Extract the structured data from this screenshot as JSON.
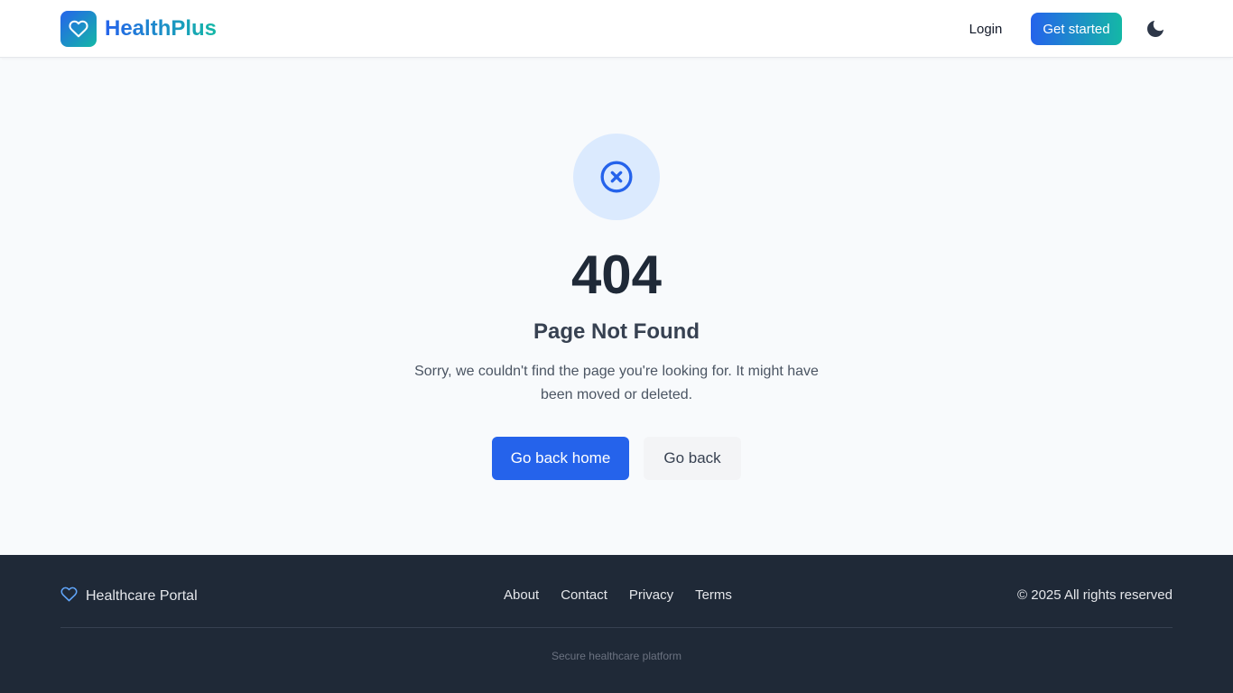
{
  "header": {
    "brand": "HealthPlus",
    "login_label": "Login",
    "get_started_label": "Get started",
    "theme_icon": "moon-icon"
  },
  "error": {
    "icon": "x-circle-icon",
    "code": "404",
    "title": "Page Not Found",
    "message": "Sorry, we couldn't find the page you're looking for. It might have been moved or deleted.",
    "home_button": "Go back home",
    "back_button": "Go back"
  },
  "footer": {
    "brand": "Healthcare Portal",
    "brand_icon": "heart-icon",
    "links": [
      {
        "label": "About"
      },
      {
        "label": "Contact"
      },
      {
        "label": "Privacy"
      },
      {
        "label": "Terms"
      }
    ],
    "copyright": "© 2025 All rights reserved",
    "note": "Secure healthcare platform"
  },
  "colors": {
    "primary": "#2563eb",
    "accent": "#14b8a6",
    "footer_bg": "#1f2937",
    "page_bg": "#f8fafc"
  }
}
